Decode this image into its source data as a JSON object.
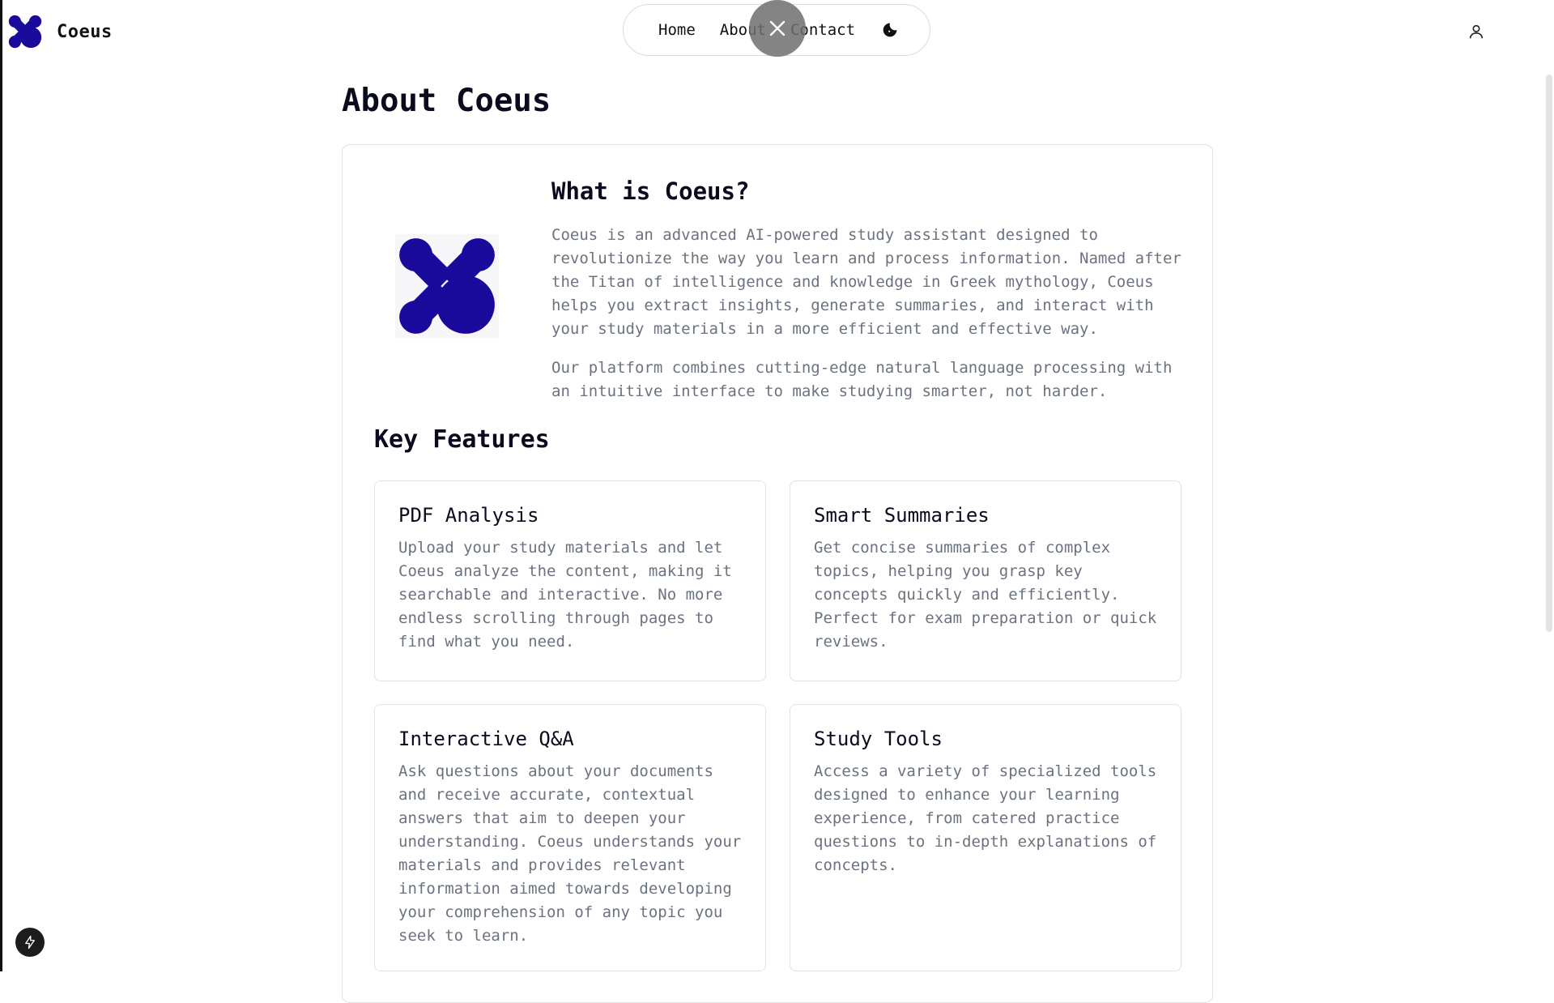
{
  "header": {
    "brand_name": "Coeus",
    "brand_color": "#1a0a9c",
    "nav": [
      {
        "label": "Home"
      },
      {
        "label": "About"
      },
      {
        "label": "Contact"
      }
    ],
    "theme_icon": "moon-icon",
    "user_icon": "user-icon",
    "overlay_icon": "close-icon"
  },
  "main": {
    "page_title": "About Coeus",
    "what_title": "What is Coeus?",
    "paragraph1": "Coeus is an advanced AI-powered study assistant designed to revolutionize the way you learn and process information. Named after the Titan of intelligence and knowledge in Greek mythology, Coeus helps you extract insights, generate summaries, and interact with your study materials in a more efficient and effective way.",
    "paragraph2": "Our platform combines cutting-edge natural language processing with an intuitive interface to make studying smarter, not harder.",
    "features_title": "Key Features",
    "features": [
      {
        "title": "PDF Analysis",
        "text": "Upload your study materials and let Coeus analyze the content, making it searchable and interactive. No more endless scrolling through pages to find what you need."
      },
      {
        "title": "Smart Summaries",
        "text": "Get concise summaries of complex topics, helping you grasp key concepts quickly and efficiently. Perfect for exam preparation or quick reviews."
      },
      {
        "title": "Interactive Q&A",
        "text": "Ask questions about your documents and receive accurate, contextual answers that aim to deepen your understanding. Coeus understands your materials and provides relevant information aimed towards developing your comprehension of any topic you seek to learn."
      },
      {
        "title": "Study Tools",
        "text": "Access a variety of specialized tools designed to enhance your learning experience, from catered practice questions to in-depth explanations of concepts."
      }
    ]
  },
  "floating": {
    "bolt_icon": "bolt-icon"
  }
}
